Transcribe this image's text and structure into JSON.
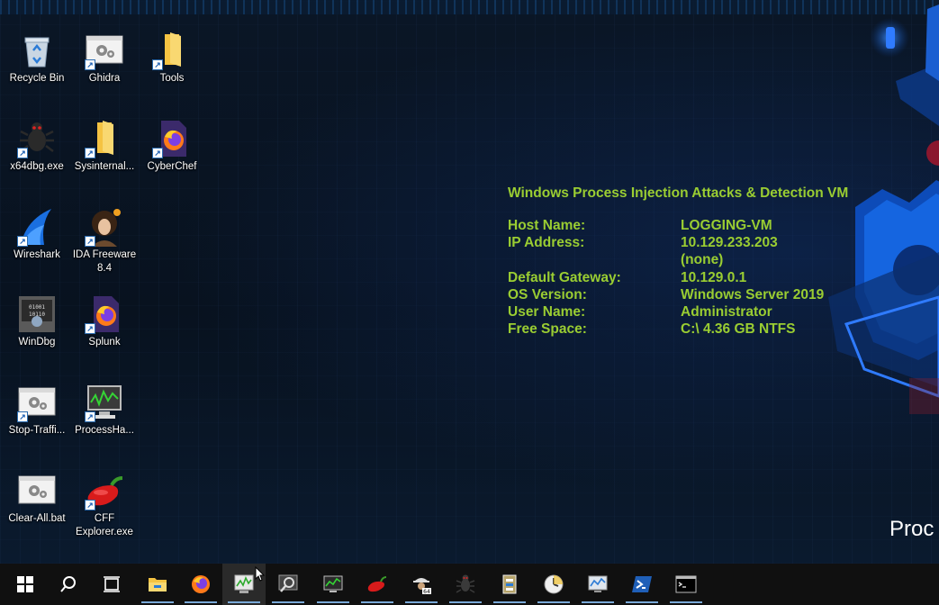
{
  "desktop": {
    "icons": [
      {
        "label": "Recycle Bin",
        "icon": "recycle-bin-icon",
        "shortcut": false
      },
      {
        "label": "Ghidra",
        "icon": "ghidra-icon",
        "shortcut": true
      },
      {
        "label": "Tools",
        "icon": "folder-icon",
        "shortcut": true
      },
      {
        "label": "x64dbg.exe",
        "icon": "x64dbg-bug-icon",
        "shortcut": true
      },
      {
        "label": "Sysinternal...",
        "icon": "folder-icon",
        "shortcut": true
      },
      {
        "label": "CyberChef",
        "icon": "firefox-icon",
        "shortcut": true
      },
      {
        "label": "Wireshark",
        "icon": "wireshark-fin-icon",
        "shortcut": true
      },
      {
        "label": "IDA Freeware 8.4",
        "label_line1": "IDA Freeware",
        "label_line2": "8.4",
        "icon": "ida-portrait-icon",
        "shortcut": true
      },
      {
        "label": "WinDbg",
        "icon": "windbg-icon",
        "shortcut": true
      },
      {
        "label": "Splunk",
        "icon": "firefox-icon",
        "shortcut": true
      },
      {
        "label": "Stop-Traffi...",
        "icon": "batch-gear-icon",
        "shortcut": true
      },
      {
        "label": "ProcessHa...",
        "icon": "process-hacker-icon",
        "shortcut": true
      },
      {
        "label": "Clear-All.bat",
        "icon": "batch-gear-icon",
        "shortcut": false
      },
      {
        "label": "CFF Explorer.exe",
        "label_line1": "CFF",
        "label_line2": "Explorer.exe",
        "icon": "chili-pepper-icon",
        "shortcut": true
      }
    ]
  },
  "info": {
    "title": "Windows Process Injection Attacks & Detection VM",
    "rows": [
      {
        "key": "Host Name:",
        "value": "LOGGING-VM"
      },
      {
        "key": "IP Address:",
        "value": "10.129.233.203"
      },
      {
        "key": "",
        "value": "(none)"
      },
      {
        "key": "Default Gateway:",
        "value": "10.129.0.1"
      },
      {
        "key": "OS Version:",
        "value": "Windows Server 2019"
      },
      {
        "key": "User Name:",
        "value": "Administrator"
      },
      {
        "key": "Free Space:",
        "value": "C:\\ 4.36 GB NTFS"
      }
    ],
    "color": "#9acd32"
  },
  "wallpaper": {
    "partial_text": "Proc"
  },
  "taskbar": {
    "items": [
      {
        "icon": "windows-start-icon"
      },
      {
        "icon": "search-icon"
      },
      {
        "icon": "task-view-icon"
      },
      {
        "icon": "file-explorer-icon",
        "running": true
      },
      {
        "icon": "firefox-icon",
        "running": true
      },
      {
        "icon": "process-hacker-icon",
        "running": true,
        "active": true
      },
      {
        "icon": "tcpview-magnifier-icon",
        "running": true
      },
      {
        "icon": "process-monitor-icon",
        "running": true
      },
      {
        "icon": "chili-pepper-icon",
        "running": true
      },
      {
        "icon": "spy-64-icon",
        "running": true
      },
      {
        "icon": "x64dbg-bug-icon",
        "running": true
      },
      {
        "icon": "pe-file-icon",
        "running": true
      },
      {
        "icon": "clock-icon",
        "running": true
      },
      {
        "icon": "performance-monitor-icon",
        "running": true
      },
      {
        "icon": "powershell-icon",
        "running": true
      },
      {
        "icon": "command-prompt-icon",
        "running": true
      }
    ]
  }
}
